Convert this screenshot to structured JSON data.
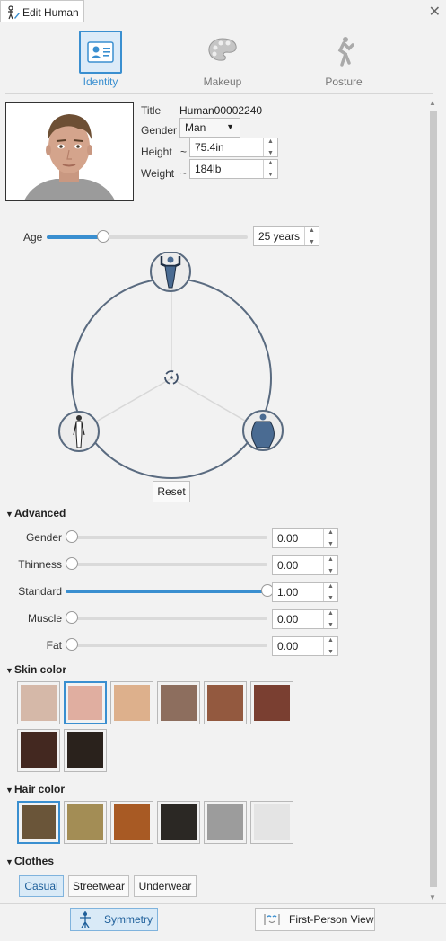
{
  "window": {
    "title": "Edit Human",
    "close_icon": "close-icon"
  },
  "tabs": [
    {
      "label": "Identity",
      "icon": "id-card-icon",
      "active": true
    },
    {
      "label": "Makeup",
      "icon": "palette-icon",
      "active": false
    },
    {
      "label": "Posture",
      "icon": "pose-figure-icon",
      "active": false
    }
  ],
  "identity": {
    "title_label": "Title",
    "title_value": "Human00002240",
    "gender_label": "Gender",
    "gender_value": "Man",
    "height_label": "Height",
    "height_prefix": "~",
    "height_value": "75.4in",
    "weight_label": "Weight",
    "weight_prefix": "~",
    "weight_value": "184lb"
  },
  "age": {
    "label": "Age",
    "value": "25 years",
    "fraction": 0.28
  },
  "body_shape": {
    "reset_label": "Reset"
  },
  "advanced": {
    "header": "Advanced",
    "sliders": [
      {
        "label": "Gender",
        "value": "0.00",
        "fraction": 0.0
      },
      {
        "label": "Thinness",
        "value": "0.00",
        "fraction": 0.0
      },
      {
        "label": "Standard",
        "value": "1.00",
        "fraction": 1.0
      },
      {
        "label": "Muscle",
        "value": "0.00",
        "fraction": 0.0
      },
      {
        "label": "Fat",
        "value": "0.00",
        "fraction": 0.0
      }
    ]
  },
  "skin_color": {
    "header": "Skin color",
    "swatches": [
      "#d5b8a8",
      "#e0aea0",
      "#ddb08c",
      "#8d6e5e",
      "#93593f",
      "#7a3f31",
      "#432820",
      "#2a221c"
    ],
    "selected": 1
  },
  "hair_color": {
    "header": "Hair color",
    "swatches": [
      "#6a5539",
      "#a38d55",
      "#a85a24",
      "#2b2824",
      "#9c9c9c",
      "#e4e4e4"
    ],
    "selected": 0
  },
  "clothes": {
    "header": "Clothes",
    "options": [
      {
        "label": "Casual",
        "active": true
      },
      {
        "label": "Streetwear",
        "active": false
      },
      {
        "label": "Underwear",
        "active": false
      }
    ]
  },
  "footer": {
    "symmetry_label": "Symmetry",
    "first_person_label": "First-Person View"
  },
  "colors": {
    "accent": "#3a8fd0",
    "circle_stroke": "#5a6b80",
    "figure": "#4a6b92"
  }
}
